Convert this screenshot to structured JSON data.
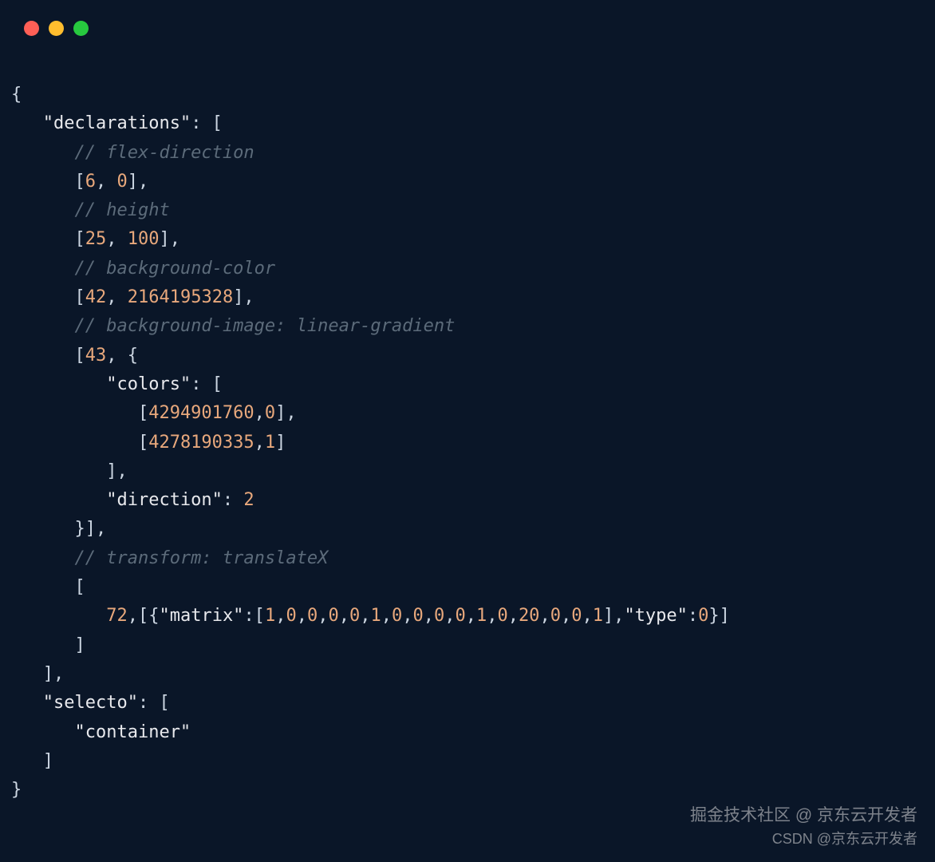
{
  "windowControls": {
    "red": "#ff5f56",
    "yellow": "#ffbd2e",
    "green": "#27c93f"
  },
  "code": {
    "lines": [
      {
        "indent": 0,
        "tokens": [
          {
            "t": "punct",
            "v": "{"
          }
        ]
      },
      {
        "indent": 1,
        "tokens": [
          {
            "t": "string",
            "v": "\"declarations\""
          },
          {
            "t": "punct",
            "v": ": ["
          }
        ]
      },
      {
        "indent": 2,
        "tokens": [
          {
            "t": "comment",
            "v": "// flex-direction"
          }
        ]
      },
      {
        "indent": 2,
        "tokens": [
          {
            "t": "punct",
            "v": "["
          },
          {
            "t": "number",
            "v": "6"
          },
          {
            "t": "punct",
            "v": ", "
          },
          {
            "t": "number",
            "v": "0"
          },
          {
            "t": "punct",
            "v": "],"
          }
        ]
      },
      {
        "indent": 2,
        "tokens": [
          {
            "t": "comment",
            "v": "// height"
          }
        ]
      },
      {
        "indent": 2,
        "tokens": [
          {
            "t": "punct",
            "v": "["
          },
          {
            "t": "number",
            "v": "25"
          },
          {
            "t": "punct",
            "v": ", "
          },
          {
            "t": "number",
            "v": "100"
          },
          {
            "t": "punct",
            "v": "],"
          }
        ]
      },
      {
        "indent": 2,
        "tokens": [
          {
            "t": "comment",
            "v": "// background-color"
          }
        ]
      },
      {
        "indent": 2,
        "tokens": [
          {
            "t": "punct",
            "v": "["
          },
          {
            "t": "number",
            "v": "42"
          },
          {
            "t": "punct",
            "v": ", "
          },
          {
            "t": "number",
            "v": "2164195328"
          },
          {
            "t": "punct",
            "v": "],"
          }
        ]
      },
      {
        "indent": 2,
        "tokens": [
          {
            "t": "comment",
            "v": "// background-image: linear-gradient"
          }
        ]
      },
      {
        "indent": 2,
        "tokens": [
          {
            "t": "punct",
            "v": "["
          },
          {
            "t": "number",
            "v": "43"
          },
          {
            "t": "punct",
            "v": ", {"
          }
        ]
      },
      {
        "indent": 3,
        "tokens": [
          {
            "t": "string",
            "v": "\"colors\""
          },
          {
            "t": "punct",
            "v": ": ["
          }
        ]
      },
      {
        "indent": 4,
        "tokens": [
          {
            "t": "punct",
            "v": "["
          },
          {
            "t": "number",
            "v": "4294901760"
          },
          {
            "t": "punct",
            "v": ","
          },
          {
            "t": "number",
            "v": "0"
          },
          {
            "t": "punct",
            "v": "],"
          }
        ]
      },
      {
        "indent": 4,
        "tokens": [
          {
            "t": "punct",
            "v": "["
          },
          {
            "t": "number",
            "v": "4278190335"
          },
          {
            "t": "punct",
            "v": ","
          },
          {
            "t": "number",
            "v": "1"
          },
          {
            "t": "punct",
            "v": "]"
          }
        ]
      },
      {
        "indent": 3,
        "tokens": [
          {
            "t": "punct",
            "v": "],"
          }
        ]
      },
      {
        "indent": 3,
        "tokens": [
          {
            "t": "string",
            "v": "\"direction\""
          },
          {
            "t": "punct",
            "v": ": "
          },
          {
            "t": "number",
            "v": "2"
          }
        ]
      },
      {
        "indent": 2,
        "tokens": [
          {
            "t": "punct",
            "v": "}],"
          }
        ]
      },
      {
        "indent": 2,
        "tokens": [
          {
            "t": "comment",
            "v": "// transform: translateX"
          }
        ]
      },
      {
        "indent": 2,
        "tokens": [
          {
            "t": "punct",
            "v": "["
          }
        ]
      },
      {
        "indent": 3,
        "tokens": [
          {
            "t": "number",
            "v": "72"
          },
          {
            "t": "punct",
            "v": ",[{"
          },
          {
            "t": "string",
            "v": "\"matrix\""
          },
          {
            "t": "punct",
            "v": ":["
          },
          {
            "t": "number",
            "v": "1"
          },
          {
            "t": "punct",
            "v": ","
          },
          {
            "t": "number",
            "v": "0"
          },
          {
            "t": "punct",
            "v": ","
          },
          {
            "t": "number",
            "v": "0"
          },
          {
            "t": "punct",
            "v": ","
          },
          {
            "t": "number",
            "v": "0"
          },
          {
            "t": "punct",
            "v": ","
          },
          {
            "t": "number",
            "v": "0"
          },
          {
            "t": "punct",
            "v": ","
          },
          {
            "t": "number",
            "v": "1"
          },
          {
            "t": "punct",
            "v": ","
          },
          {
            "t": "number",
            "v": "0"
          },
          {
            "t": "punct",
            "v": ","
          },
          {
            "t": "number",
            "v": "0"
          },
          {
            "t": "punct",
            "v": ","
          },
          {
            "t": "number",
            "v": "0"
          },
          {
            "t": "punct",
            "v": ","
          },
          {
            "t": "number",
            "v": "0"
          },
          {
            "t": "punct",
            "v": ","
          },
          {
            "t": "number",
            "v": "1"
          },
          {
            "t": "punct",
            "v": ","
          },
          {
            "t": "number",
            "v": "0"
          },
          {
            "t": "punct",
            "v": ","
          },
          {
            "t": "number",
            "v": "20"
          },
          {
            "t": "punct",
            "v": ","
          },
          {
            "t": "number",
            "v": "0"
          },
          {
            "t": "punct",
            "v": ","
          },
          {
            "t": "number",
            "v": "0"
          },
          {
            "t": "punct",
            "v": ","
          },
          {
            "t": "number",
            "v": "1"
          },
          {
            "t": "punct",
            "v": "],"
          },
          {
            "t": "string",
            "v": "\"type\""
          },
          {
            "t": "punct",
            "v": ":"
          },
          {
            "t": "number",
            "v": "0"
          },
          {
            "t": "punct",
            "v": "}]"
          }
        ]
      },
      {
        "indent": 2,
        "tokens": [
          {
            "t": "punct",
            "v": "]"
          }
        ]
      },
      {
        "indent": 1,
        "tokens": [
          {
            "t": "punct",
            "v": "],"
          }
        ]
      },
      {
        "indent": 1,
        "tokens": [
          {
            "t": "string",
            "v": "\"selecto\""
          },
          {
            "t": "punct",
            "v": ": ["
          }
        ]
      },
      {
        "indent": 2,
        "tokens": [
          {
            "t": "string",
            "v": "\"container\""
          }
        ]
      },
      {
        "indent": 1,
        "tokens": [
          {
            "t": "punct",
            "v": "]"
          }
        ]
      },
      {
        "indent": 0,
        "tokens": [
          {
            "t": "punct",
            "v": "}"
          }
        ]
      }
    ]
  },
  "watermark": {
    "line1": "掘金技术社区 @ 京东云开发者",
    "line2": "CSDN @京东云开发者"
  }
}
